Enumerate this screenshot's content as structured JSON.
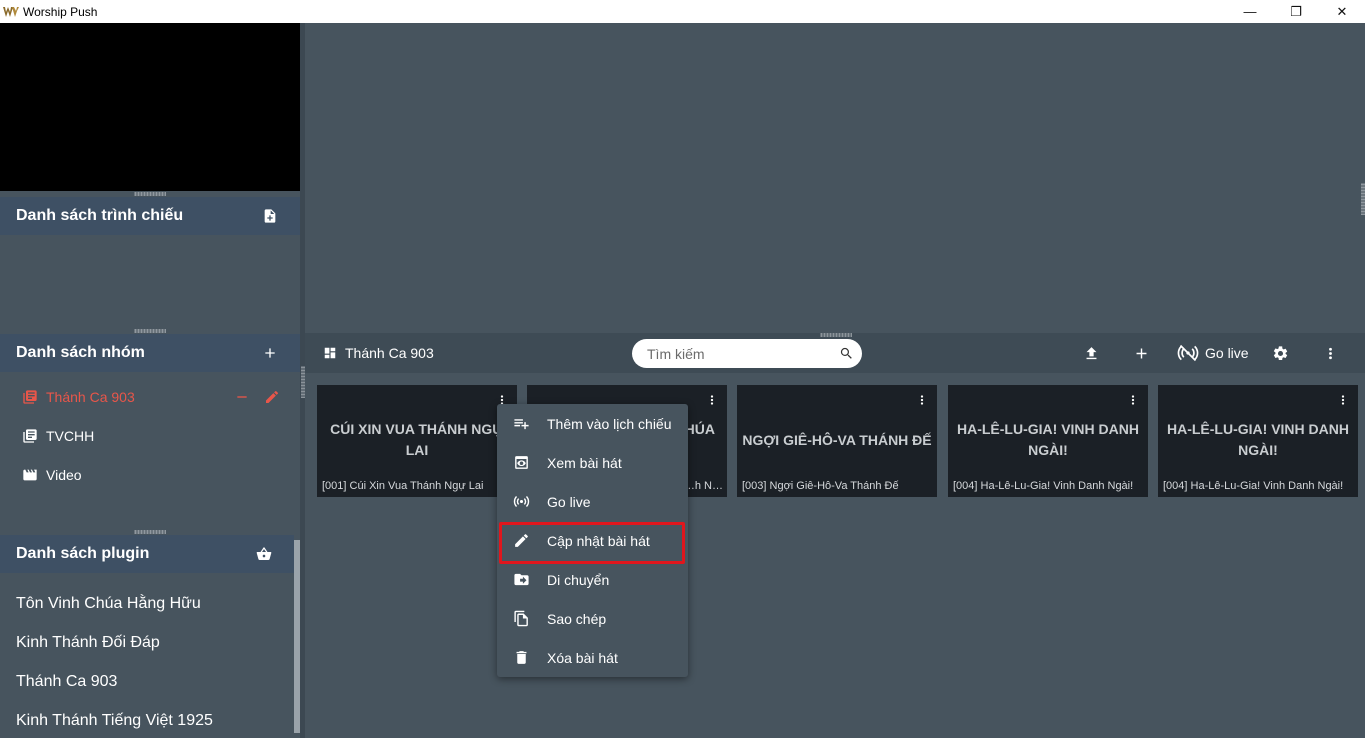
{
  "window": {
    "title": "Worship Push",
    "minimize": "—",
    "restore": "❐",
    "close": "✕"
  },
  "panels": {
    "schedule": {
      "title": "Danh sách trình chiếu"
    },
    "groups": {
      "title": "Danh sách nhóm",
      "items": [
        {
          "label": "Thánh Ca 903",
          "icon": "library-icon",
          "active": true
        },
        {
          "label": "TVCHH",
          "icon": "library-icon"
        },
        {
          "label": "Video",
          "icon": "movie-icon"
        }
      ]
    },
    "plugins": {
      "title": "Danh sách plugin",
      "items": [
        {
          "label": "Tôn Vinh Chúa Hằng Hữu"
        },
        {
          "label": "Kinh Thánh Đối Đáp"
        },
        {
          "label": "Thánh Ca 903"
        },
        {
          "label": "Kinh Thánh Tiếng Việt 1925"
        }
      ]
    }
  },
  "toolbar": {
    "title": "Thánh Ca 903",
    "search_placeholder": "Tìm kiếm",
    "golive_label": "Go live"
  },
  "songs": [
    {
      "title": "CÚI XIN VUA THÁNH NGỰ LAI",
      "subtitle": "[001] Cúi Xin Vua Thánh Ngự Lai"
    },
    {
      "title": "HÚA",
      "subtitle": "…h N…"
    },
    {
      "title": "NGỢI GIÊ-HÔ-VA THÁNH ĐẾ",
      "subtitle": "[003] Ngợi Giê-Hô-Va Thánh Đế"
    },
    {
      "title": "HA-LÊ-LU-GIA! VINH DANH NGÀI!",
      "subtitle": "[004] Ha-Lê-Lu-Gia! Vinh Danh Ngài!"
    },
    {
      "title": "HA-LÊ-LU-GIA! VINH DANH NGÀI!",
      "subtitle": "[004] Ha-Lê-Lu-Gia! Vinh Danh Ngài!"
    }
  ],
  "context_menu": {
    "items": [
      {
        "label": "Thêm vào lịch chiếu",
        "icon": "playlist-add-icon"
      },
      {
        "label": "Xem bài hát",
        "icon": "preview-icon"
      },
      {
        "label": "Go live",
        "icon": "broadcast-icon"
      },
      {
        "label": "Cập nhật bài hát",
        "icon": "edit-icon",
        "highlighted": true
      },
      {
        "label": "Di chuyển",
        "icon": "move-folder-icon"
      },
      {
        "label": "Sao chép",
        "icon": "copy-icon"
      },
      {
        "label": "Xóa bài hát",
        "icon": "delete-icon"
      }
    ],
    "highlight_color": "#e0161d"
  },
  "colors": {
    "background": "#47545e",
    "panel_header": "#3e5064",
    "active_group": "#e8564a",
    "card": "#1b2026"
  }
}
